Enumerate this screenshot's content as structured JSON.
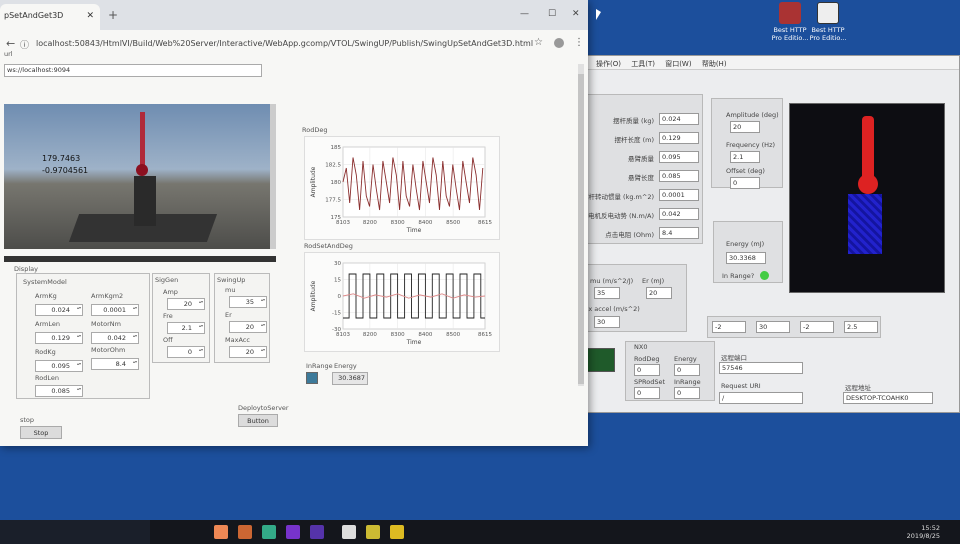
{
  "browser": {
    "tab_title": "pSetAndGet3D",
    "url": "localhost:50843/HtmlVI/Build/Web%20Server/Interactive/WebApp.gcomp/VTOL/SwingUP/Publish/SwingUpSetAndGet3D.html"
  },
  "url_section": {
    "label": "url",
    "value": "ws://localhost:9094"
  },
  "unity_view": {
    "line1": "179.7463",
    "line2": "-0.9704561"
  },
  "display_label": "Display",
  "system_model": {
    "title": "SystemModel",
    "arm_kg_label": "ArmKg",
    "arm_kg": "0.024",
    "arm_kgm2_label": "ArmKgm2",
    "arm_kgm2": "0.0001",
    "arm_len_label": "ArmLen",
    "arm_len": "0.129",
    "motor_nm_label": "MotorNm",
    "motor_nm": "0.042",
    "rod_kg_label": "RodKg",
    "rod_kg": "0.095",
    "motor_ohm_label": "MotorOhm",
    "motor_ohm": "8.4",
    "rod_len_label": "RodLen",
    "rod_len": "0.085"
  },
  "sig_gen": {
    "title": "SigGen",
    "amp_label": "Amp",
    "amp": "20",
    "fre_label": "Fre",
    "fre": "2.1",
    "off_label": "Off",
    "off": "0"
  },
  "swing_up": {
    "title": "SwingUp",
    "mu_label": "mu",
    "mu": "35",
    "er_label": "Er",
    "er": "20",
    "max_acc_label": "MaxAcc",
    "max_acc": "20"
  },
  "stop": {
    "label": "stop",
    "button": "Stop"
  },
  "deploy": {
    "label": "DeploytoServer",
    "button": "Button"
  },
  "rod_deg_chart": {
    "title": "RodDeg",
    "xlabel": "Time",
    "ylabel": "Amplitude",
    "yticks": [
      "185",
      "182.5",
      "180",
      "177.5",
      "175"
    ],
    "xticks": [
      "8103",
      "8200",
      "8300",
      "8400",
      "8500",
      "8615"
    ]
  },
  "rod_set_chart": {
    "title": "RodSetAndDeg",
    "xlabel": "Time",
    "ylabel": "Amplitude",
    "yticks": [
      "30",
      "15",
      "0",
      "-15",
      "-30"
    ],
    "xticks": [
      "8103",
      "8200",
      "8300",
      "8400",
      "8500",
      "8615"
    ]
  },
  "in_range": {
    "label": "InRange",
    "energy_label": "Energy",
    "energy": "30.3687"
  },
  "chart_data": [
    {
      "type": "line",
      "title": "RodDeg",
      "xlabel": "Time",
      "ylabel": "Amplitude",
      "xlim": [
        8103,
        8615
      ],
      "ylim": [
        175,
        185
      ],
      "series": [
        {
          "x": [
            8103,
            8115,
            8127,
            8139,
            8151,
            8163,
            8175,
            8187,
            8199,
            8211,
            8223,
            8235,
            8247,
            8259,
            8271,
            8283,
            8295,
            8307,
            8319,
            8331,
            8343,
            8355,
            8367,
            8379,
            8391,
            8403,
            8415,
            8427,
            8439,
            8451,
            8463,
            8475,
            8487,
            8499,
            8511,
            8523,
            8535,
            8547,
            8559,
            8571,
            8583,
            8595,
            8607
          ],
          "y": [
            180,
            182,
            177,
            183.5,
            181,
            176,
            183,
            178,
            176.5,
            182.5,
            179,
            176,
            183,
            180,
            177,
            183.5,
            181,
            176,
            183,
            178,
            176.5,
            182.5,
            179,
            176,
            183,
            180,
            177,
            183.5,
            181,
            176,
            183,
            178,
            176.5,
            182.5,
            179,
            176,
            183,
            180,
            177,
            183.5,
            181,
            176,
            182
          ]
        }
      ]
    },
    {
      "type": "line",
      "title": "RodSetAndDeg",
      "xlabel": "Time",
      "ylabel": "Amplitude",
      "xlim": [
        8103,
        8615
      ],
      "ylim": [
        -30,
        30
      ],
      "series": [
        {
          "x": [
            8103,
            8125,
            8125,
            8150,
            8150,
            8175,
            8175,
            8200,
            8200,
            8225,
            8225,
            8250,
            8250,
            8275,
            8275,
            8300,
            8300,
            8325,
            8325,
            8350,
            8350,
            8375,
            8375,
            8400,
            8400,
            8425,
            8425,
            8450,
            8450,
            8475,
            8475,
            8500,
            8500,
            8525,
            8525,
            8550,
            8550,
            8575,
            8575,
            8600,
            8600,
            8615
          ],
          "y": [
            -20,
            -20,
            20,
            20,
            -20,
            -20,
            20,
            20,
            -20,
            -20,
            20,
            20,
            -20,
            -20,
            20,
            20,
            -20,
            -20,
            20,
            20,
            -20,
            -20,
            20,
            20,
            -20,
            -20,
            20,
            20,
            -20,
            -20,
            20,
            20,
            -20,
            -20,
            20,
            20,
            -20,
            -20,
            20,
            20,
            -20,
            -20
          ]
        },
        {
          "x": [
            8103,
            8140,
            8180,
            8220,
            8260,
            8300,
            8340,
            8380,
            8420,
            8460,
            8500,
            8540,
            8580,
            8615
          ],
          "y": [
            0,
            2,
            -2,
            1,
            -1,
            2,
            -2,
            1,
            -1,
            2,
            -2,
            1,
            -1,
            0
          ]
        }
      ]
    }
  ],
  "labview": {
    "menu": [
      "操作(O)",
      "工具(T)",
      "窗口(W)",
      "帮助(H)"
    ],
    "params": [
      {
        "label": "摆杆质量 (kg)",
        "value": "0.024"
      },
      {
        "label": "摆杆长度 (m)",
        "value": "0.129"
      },
      {
        "label": "悬臂质量",
        "value": "0.095"
      },
      {
        "label": "悬臂长度",
        "value": "0.085"
      },
      {
        "label": "摆杆转动惯量 (kg.m^2)",
        "value": "0.0001"
      },
      {
        "label": "电机反电动势 (N.m/A)",
        "value": "0.042"
      },
      {
        "label": "点击电阻 (Ohm)",
        "value": "8.4"
      }
    ],
    "amplitude_label": "Amplitude (deg)",
    "amplitude": "20",
    "frequency_label": "Frequency (Hz)",
    "frequency": "2.1",
    "offset_label": "Offset (deg)",
    "offset": "0",
    "mu_label": "mu (m/s^2/J)",
    "mu": "35",
    "er_label": "Er (mJ)",
    "er": "20",
    "max_accel_label": "max accel (m/s^2)",
    "max_accel": "30",
    "energy_label": "Energy (mJ)",
    "energy": "30.3368",
    "in_range_label": "In Range?",
    "bottom_values": [
      "-2",
      "30",
      "-2",
      "2.5"
    ],
    "nx_label": "NX0",
    "rod_deg_label": "RodDeg",
    "rod_deg": "0",
    "energy2_label": "Energy",
    "energy2": "0",
    "sp_rod_set_label": "SPRodSet",
    "sp_rod_set": "0",
    "in_range2_label": "InRange",
    "in_range2": "0",
    "port_label": "远程端口",
    "port": "57546",
    "request_uri_label": "Request URI",
    "request_uri": "/",
    "remote_addr_label": "远程地址",
    "remote_addr": "DESKTOP-TCOAHK0"
  },
  "desktop": [
    {
      "label": "Best HTTP Pro Editio...",
      "color": "#c33"
    },
    {
      "label": "Best HTTP Pro Editio...",
      "color": "#222"
    }
  ],
  "tray": {
    "time": "15:52",
    "date": "2019/8/25"
  }
}
